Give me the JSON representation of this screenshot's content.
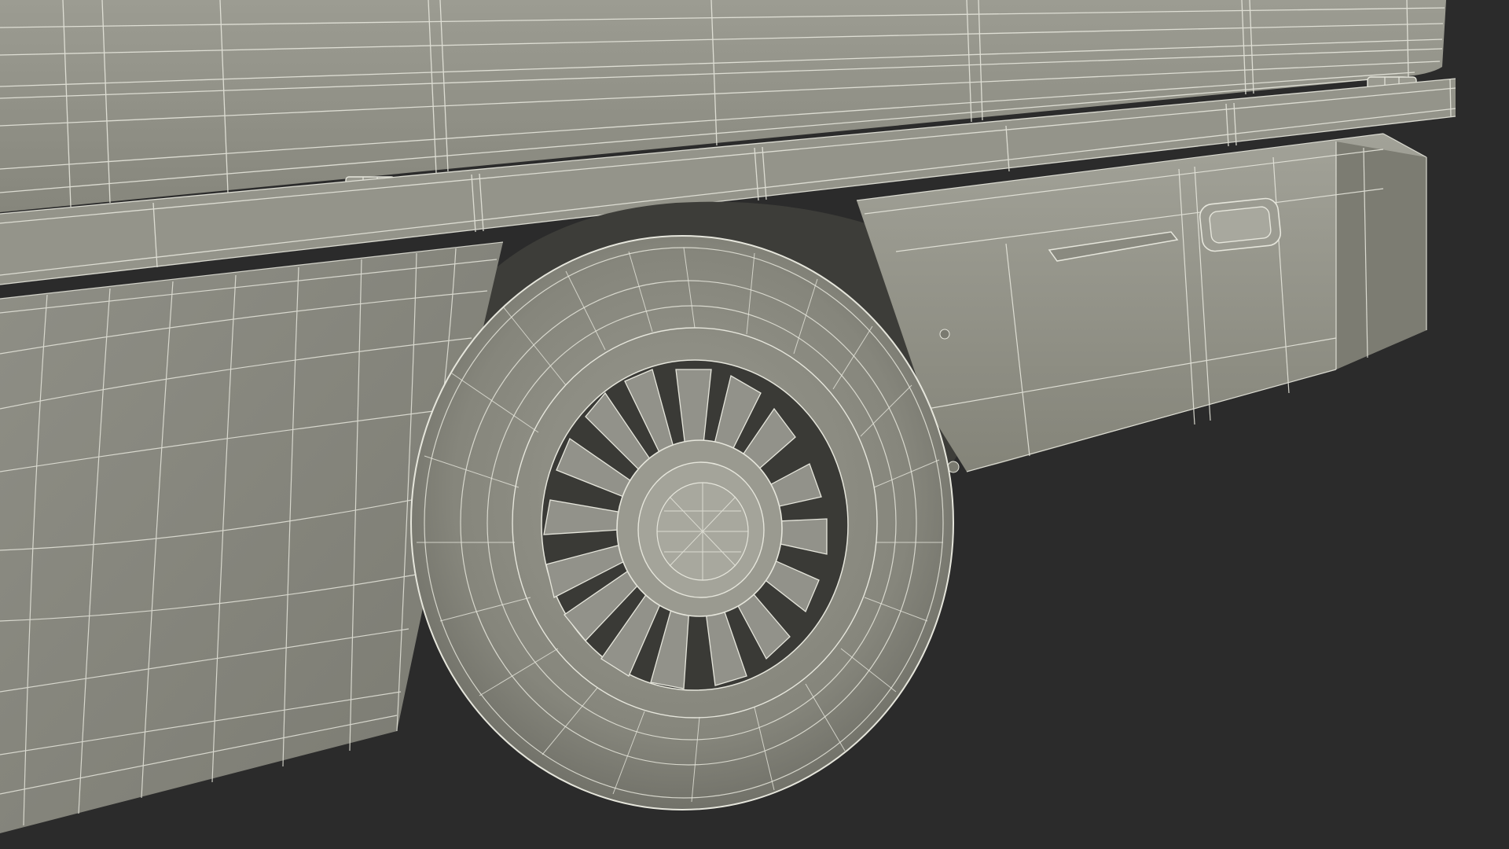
{
  "scene": {
    "subject": "wireframe-render-vehicle-rear-wheel",
    "colors": {
      "background": "#2b2b2b",
      "surface": "#8a8a80",
      "surface_light": "#a3a398",
      "surface_dark": "#6e6e66",
      "wire": "#e6e6dc",
      "hub_shadow": "#3a3a36"
    }
  }
}
